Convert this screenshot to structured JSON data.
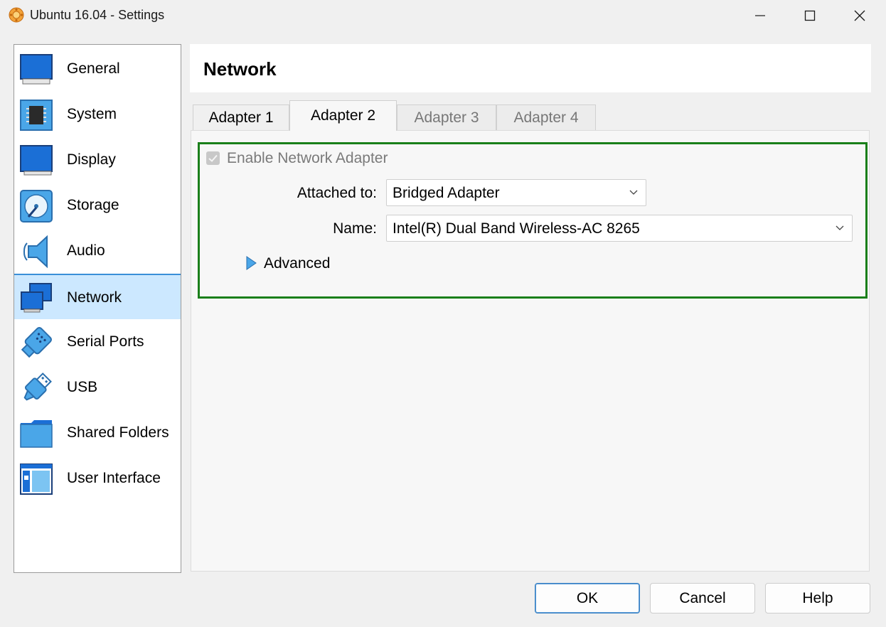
{
  "window": {
    "title": "Ubuntu 16.04 - Settings"
  },
  "sidebar": {
    "items": [
      {
        "label": "General",
        "icon": "monitor-icon"
      },
      {
        "label": "System",
        "icon": "chip-icon"
      },
      {
        "label": "Display",
        "icon": "display-icon"
      },
      {
        "label": "Storage",
        "icon": "disk-icon"
      },
      {
        "label": "Audio",
        "icon": "speaker-icon"
      },
      {
        "label": "Network",
        "icon": "network-icon",
        "selected": true
      },
      {
        "label": "Serial Ports",
        "icon": "serial-port-icon"
      },
      {
        "label": "USB",
        "icon": "usb-icon"
      },
      {
        "label": "Shared Folders",
        "icon": "folder-icon"
      },
      {
        "label": "User Interface",
        "icon": "user-interface-icon"
      }
    ]
  },
  "page": {
    "title": "Network"
  },
  "tabs": [
    {
      "label": "Adapter 1"
    },
    {
      "label": "Adapter 2",
      "selected": true
    },
    {
      "label": "Adapter 3",
      "disabled": true
    },
    {
      "label": "Adapter 4",
      "disabled": true
    }
  ],
  "adapter": {
    "enable_label": "Enable Network Adapter",
    "enabled": true,
    "attached_label": "Attached to:",
    "attached_value": "Bridged Adapter",
    "name_label": "Name:",
    "name_value": "Intel(R) Dual Band Wireless-AC 8265",
    "advanced_label": "Advanced"
  },
  "buttons": {
    "ok": "OK",
    "cancel": "Cancel",
    "help": "Help"
  },
  "colors": {
    "accent": "#3a8fd8",
    "selection": "#cce8ff",
    "highlight_border": "#1a7f1a"
  }
}
